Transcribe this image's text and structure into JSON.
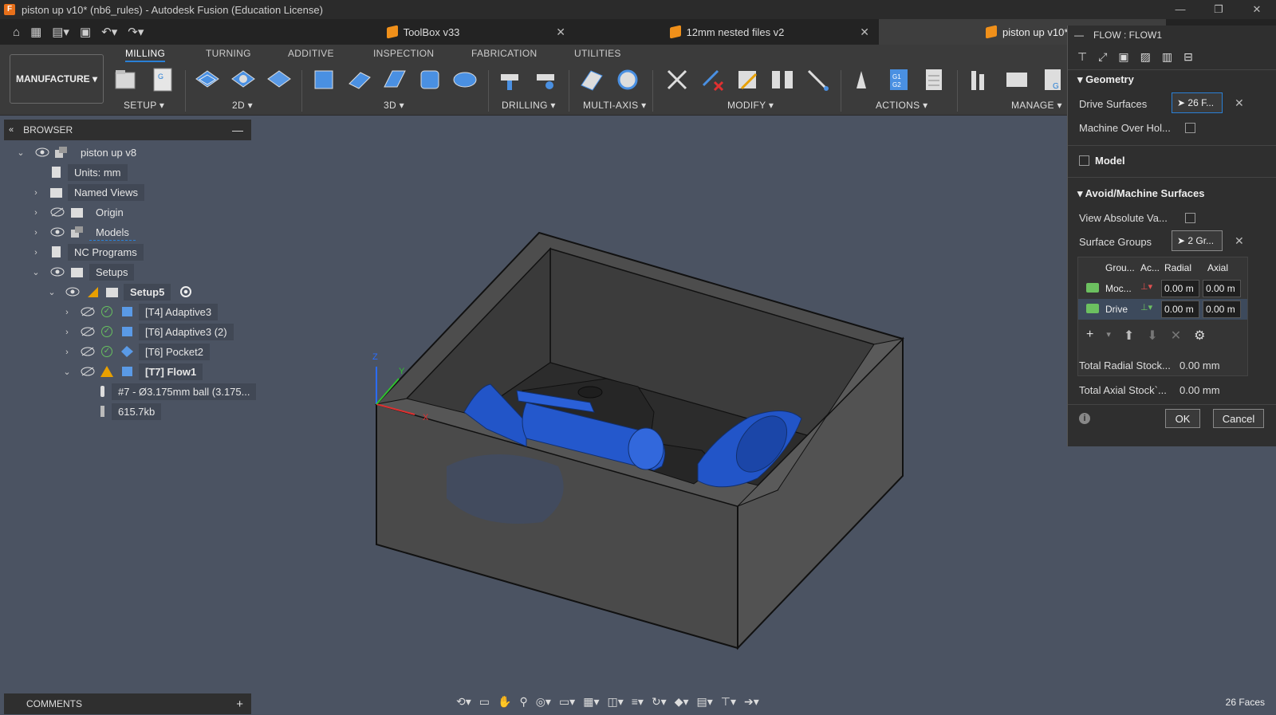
{
  "window": {
    "title": "piston up v10* (nb6_rules) - Autodesk Fusion (Education License)"
  },
  "tabs": [
    {
      "label": "ToolBox v33"
    },
    {
      "label": "12mm nested files v2"
    },
    {
      "label": "piston up v10*"
    }
  ],
  "ribbon": {
    "workspace": "MANUFACTURE",
    "tabs": [
      "MILLING",
      "TURNING",
      "ADDITIVE",
      "INSPECTION",
      "FABRICATION",
      "UTILITIES"
    ],
    "groups": [
      "SETUP",
      "2D",
      "3D",
      "DRILLING",
      "MULTI-AXIS",
      "MODIFY",
      "ACTIONS",
      "MANAGE"
    ]
  },
  "browser": {
    "title": "BROWSER",
    "items": {
      "root": "piston up v8",
      "units": "Units: mm",
      "named_views": "Named Views",
      "origin": "Origin",
      "models": "Models",
      "nc_programs": "NC Programs",
      "setups": "Setups",
      "setup5": "Setup5",
      "op1": "[T4] Adaptive3",
      "op2": "[T6] Adaptive3 (2)",
      "op3": "[T6] Pocket2",
      "op4": "[T7] Flow1",
      "tool": "#7 - Ø3.175mm ball (3.175...",
      "size": "615.7kb"
    }
  },
  "comments": {
    "label": "COMMENTS"
  },
  "status": {
    "faces": "26 Faces"
  },
  "panel": {
    "title": "FLOW : FLOW1",
    "geometry": "Geometry",
    "drive_surfaces_label": "Drive Surfaces",
    "drive_surfaces_value": "26 F...",
    "machine_over_label": "Machine Over Hol...",
    "model_label": "Model",
    "avoid_section": "Avoid/Machine Surfaces",
    "view_absolute_label": "View Absolute Va...",
    "surface_groups_label": "Surface Groups",
    "surface_groups_value": "2 Gr...",
    "table_headers": [
      "Grou...",
      "Ac...",
      "Radial",
      "Axial"
    ],
    "rows": [
      {
        "name": "Moc...",
        "radial": "0.00 m",
        "axial": "0.00 m"
      },
      {
        "name": "Drive",
        "radial": "0.00 m",
        "axial": "0.00 m"
      }
    ],
    "total_radial_label": "Total Radial Stock...",
    "total_radial_value": "0.00 mm",
    "total_axial_label": "Total Axial Stock`...",
    "total_axial_value": "0.00 mm",
    "ok": "OK",
    "cancel": "Cancel"
  },
  "viewport": {
    "axes": {
      "z": "Z",
      "y": "Y",
      "x": "X"
    }
  },
  "colors": {
    "accent": "#2a80d6",
    "part_blue": "#2255c8",
    "stock_gray": "#4a4a4a",
    "viewport_bg": "#4b5362"
  }
}
